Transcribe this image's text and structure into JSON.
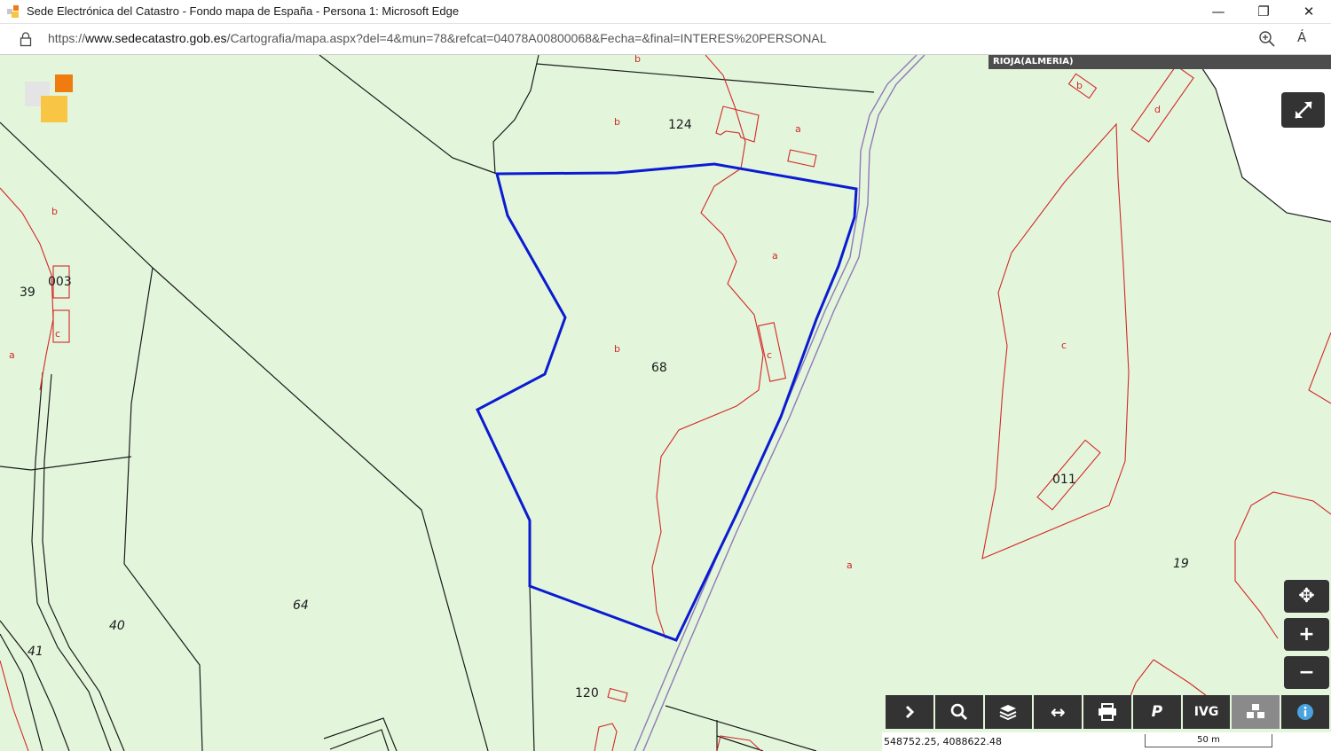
{
  "window": {
    "title": "Sede Electrónica del Catastro - Fondo mapa de España - Persona 1: Microsoft Edge",
    "minimize": "—",
    "restore": "❐",
    "close": "✕"
  },
  "address": {
    "url_prefix": "https://",
    "url_host": "www.sedecatastro.gob.es",
    "url_path": "/Cartografia/mapa.aspx?del=4&mun=78&refcat=04078A00800068&Fecha=&final=INTERES%20PERSONAL",
    "read_aloud": "Á"
  },
  "map": {
    "municipality": "RIOJA(ALMERIA)",
    "parcels": {
      "p124": "124",
      "p68": "68",
      "p39": "39",
      "p003": "003",
      "p64": "64",
      "p40": "40",
      "p41": "41",
      "p120": "120",
      "p19": "19",
      "p011": "011"
    },
    "subparcels": {
      "b1": "b",
      "b2": "b",
      "b3": "b",
      "b4": "b",
      "b5": "b",
      "a1": "a",
      "a2": "a",
      "a3": "a",
      "a4": "a",
      "c1": "c",
      "c2": "c",
      "c3": "c",
      "d1": "d"
    },
    "colors": {
      "background": "#e3f6dc",
      "selected_parcel": "#0b1bd1",
      "subparcel_lines": "#d42828",
      "parcel_lines": "#1b1b1b"
    }
  },
  "controls": {
    "zoom_in": "+",
    "zoom_out": "−",
    "center": "✥",
    "toolbar": {
      "expand": "›",
      "search": "search",
      "layers": "layers",
      "measure": "↔",
      "print": "print",
      "ref": "P",
      "ivg": "IVG",
      "cubes": "cubes",
      "info": "i"
    }
  },
  "status": {
    "coordinates": "548752.25, 4088622.48",
    "scale": "50 m"
  }
}
